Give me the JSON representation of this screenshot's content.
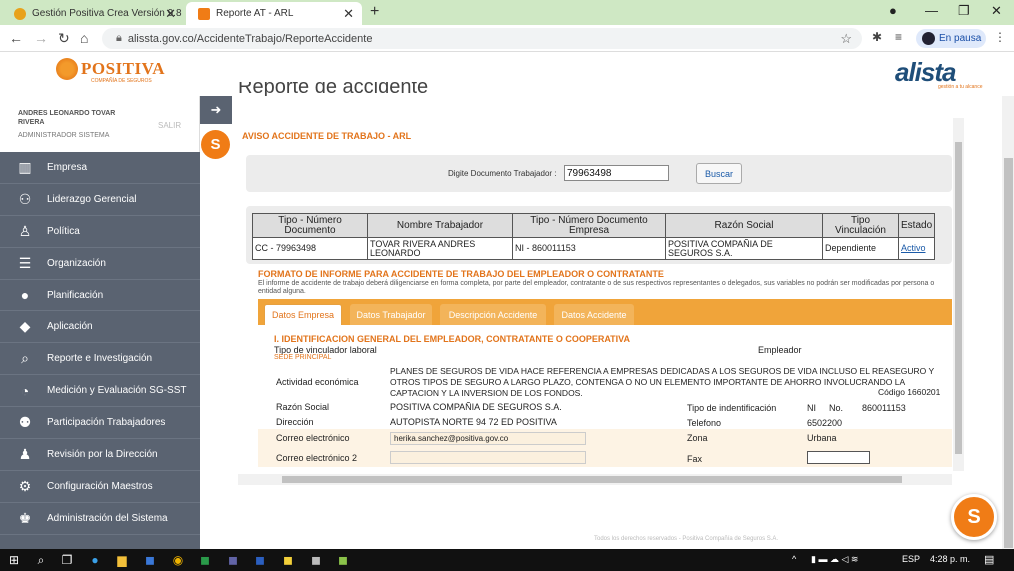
{
  "browser": {
    "tabs": [
      {
        "label": "Gestión Positiva Crea Versión 9.8",
        "active": false
      },
      {
        "label": "Reporte AT - ARL",
        "active": true
      }
    ],
    "new_tab": "+",
    "url": "alissta.gov.co/AccidenteTrabajo/ReporteAccidente",
    "profile_status": "En pausa"
  },
  "header": {
    "logo_text": "POSITIVA",
    "logo_sub": "COMPAÑÍA DE SEGUROS",
    "brand": "alista",
    "brand_sub": "gestión a tu alcance"
  },
  "sidebar": {
    "user_name": "ANDRES LEONARDO TOVAR RIVERA",
    "user_role": "ADMINISTRADOR SISTEMA",
    "logout": "SALIR",
    "items": [
      {
        "label": "Empresa",
        "icon": "building-icon"
      },
      {
        "label": "Liderazgo Gerencial",
        "icon": "leadership-icon"
      },
      {
        "label": "Política",
        "icon": "person-icon"
      },
      {
        "label": "Organización",
        "icon": "list-icon"
      },
      {
        "label": "Planificación",
        "icon": "head-icon"
      },
      {
        "label": "Aplicación",
        "icon": "tag-icon"
      },
      {
        "label": "Reporte e Investigación",
        "icon": "search-icon"
      },
      {
        "label": "Medición y Evaluación SG-SST",
        "icon": "pie-chart-icon"
      },
      {
        "label": "Participación Trabajadores",
        "icon": "people-icon"
      },
      {
        "label": "Revisión por la Dirección",
        "icon": "review-icon"
      },
      {
        "label": "Configuración Maestros",
        "icon": "gear-icon"
      },
      {
        "label": "Administración del Sistema",
        "icon": "admin-icon"
      }
    ]
  },
  "page": {
    "title": "Reporte de accidente",
    "aviso": "AVISO ACCIDENTE DE TRABAJO - ARL",
    "search_label": "Digite Documento Trabajador :",
    "search_value": "79963498",
    "search_button": "Buscar"
  },
  "results": {
    "headers": [
      "Tipo - Número Documento",
      "Nombre Trabajador",
      "Tipo - Número Documento Empresa",
      "Razón Social",
      "Tipo Vinculación",
      "Estado"
    ],
    "rows": [
      [
        "CC - 79963498",
        "TOVAR RIVERA ANDRES LEONARDO",
        "NI - 860011153",
        "POSITIVA COMPAÑIA DE SEGUROS S.A.",
        "Dependiente",
        "Activo"
      ]
    ]
  },
  "formato": {
    "title": "FORMATO DE INFORME PARA ACCIDENTE DE TRABAJO DEL EMPLEADOR O CONTRATANTE",
    "desc": "El informe de accidente de trabajo deberá diligenciarse en forma completa, por parte del empleador, contratante o de sus respectivos representantes o delegados, sus variables no podrán ser modificadas por persona o entidad alguna.",
    "tabs": [
      "Datos Empresa",
      "Datos Trabajador",
      "Descripción Accidente",
      "Datos Accidente"
    ],
    "section_title": "I. IDENTIFICACION GENERAL DEL EMPLEADOR, CONTRATANTE O COOPERATIVA",
    "tipo_vinculador_label": "Tipo de vinculador laboral",
    "tipo_vinculador_value": "Empleador",
    "sede": "SEDE PRINCIPAL",
    "actividad_label": "Actividad económica",
    "actividad_value": "PLANES DE SEGUROS DE VIDA HACE REFERENCIA A EMPRESAS DEDICADAS A LOS SEGUROS DE VIDA INCLUSO EL REASEGURO Y OTROS TIPOS DE SEGURO A LARGO PLAZO, CONTENGA O NO UN ELEMENTO IMPORTANTE DE AHORRO INVOLUCRANDO LA CAPTACION Y LA INVERSION DE LOS FONDOS.",
    "codigo": "Código 1660201",
    "razon_label": "Razón Social",
    "razon_value": "POSITIVA COMPAÑIA DE SEGUROS S.A.",
    "tipo_ident_label": "Tipo de indentificación",
    "tipo_ident_value": "NI",
    "no_label": "No.",
    "no_value": "860011153",
    "direccion_label": "Dirección",
    "direccion_value": "AUTOPISTA NORTE 94 72 ED POSITIVA",
    "telefono_label": "Telefono",
    "telefono_value": "6502200",
    "correo_label": "Correo electrónico",
    "correo_value": "herika.sanchez@positiva.gov.co",
    "zona_label": "Zona",
    "zona_value": "Urbana",
    "correo2_label": "Correo electrónico 2",
    "fax_label": "Fax"
  },
  "footer": "Todos los derechos reservados - Positiva Compañía de Seguros S.A.",
  "taskbar": {
    "lang": "ESP",
    "time": "4:28 p. m."
  }
}
